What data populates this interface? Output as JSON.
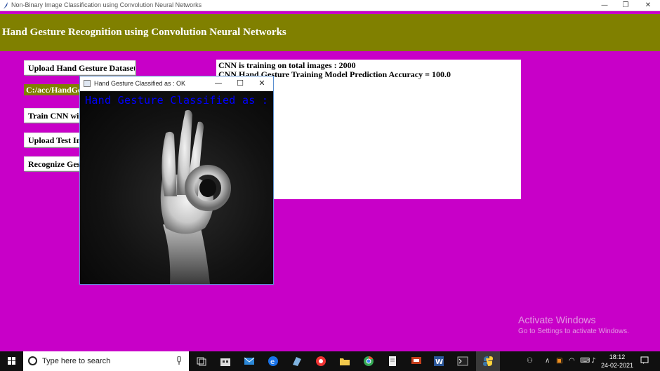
{
  "window": {
    "title": "Non-Binary Image Classification using Convolution Neural Networks",
    "minimize": "—",
    "restore": "❐",
    "close": "✕"
  },
  "header": {
    "title": "Hand Gesture Recognition using Convolution Neural Networks"
  },
  "buttons": {
    "upload_dataset": "Upload Hand Gesture Dataset",
    "dataset_path": "C:/acc/HandGesture",
    "train_cnn": "Train CNN with Gesture Images",
    "upload_test": "Upload Test Image",
    "recognize": "Recognize Gesture from Webcam"
  },
  "output": {
    "lines": [
      "CNN is training on total images : 2000",
      "CNN Hand Gesture Training Model Prediction Accuracy = 100.0"
    ]
  },
  "popup": {
    "title": "Hand Gesture Classified as : OK",
    "overlay_text": "Hand Gesture Classified as : OK",
    "minimize": "—",
    "maximize": "☐",
    "close": "✕"
  },
  "watermark": {
    "line1": "Activate Windows",
    "line2": "Go to Settings to activate Windows."
  },
  "taskbar": {
    "search_placeholder": "Type here to search",
    "time": "18:12",
    "date": "24-02-2021",
    "icons": [
      "task-view-icon",
      "store-icon",
      "mail-icon",
      "edge-icon",
      "files-icon",
      "recorder-icon",
      "folder-icon",
      "chrome-icon",
      "documents-icon",
      "presentation-icon",
      "word-icon",
      "terminal-icon",
      "python-icon"
    ]
  },
  "colors": {
    "background": "#c800c8",
    "header": "#808000",
    "overlay_text": "#0000ff"
  }
}
